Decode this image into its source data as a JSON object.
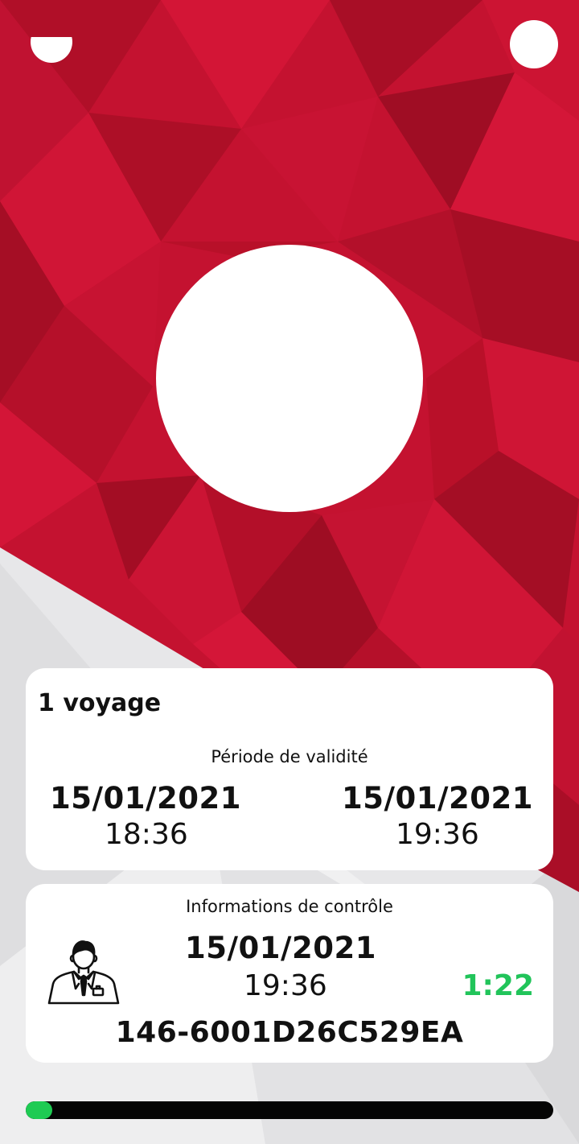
{
  "ticket": {
    "type": "1 voyage",
    "validity_title": "Période de validité",
    "start_date": "15/01/2021",
    "start_time": "18:36",
    "end_date": "15/01/2021",
    "end_time": "19:36"
  },
  "control": {
    "title": "Informations de contrôle",
    "date": "15/01/2021",
    "time": "19:36",
    "countdown": "1:22",
    "code": "146-6001D26C529EA",
    "icon": "controller-icon"
  },
  "progress": {
    "value": 0.05
  },
  "colors": {
    "brand_red": "#c41230",
    "countdown_green": "#21c45a",
    "progress_green": "#1ecb53",
    "progress_track": "#050505"
  }
}
